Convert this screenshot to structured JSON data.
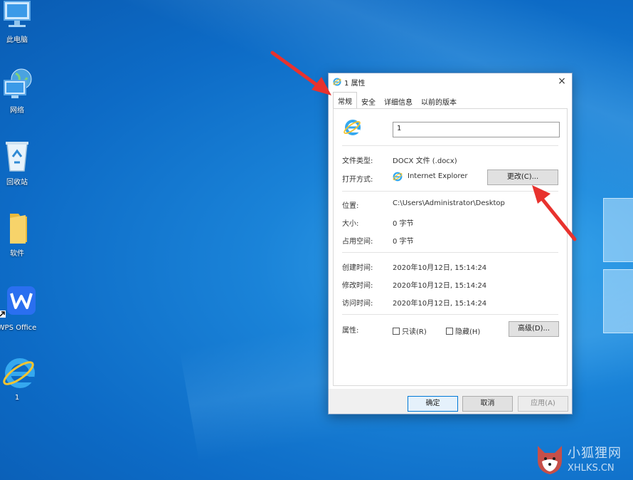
{
  "desktop": {
    "icons": [
      {
        "label": "此电脑",
        "icon": "computer-icon"
      },
      {
        "label": "网络",
        "icon": "network-icon"
      },
      {
        "label": "回收站",
        "icon": "recycle-bin-icon"
      },
      {
        "label": "软件",
        "icon": "folder-icon"
      },
      {
        "label": "WPS Office",
        "icon": "wps-office-icon"
      },
      {
        "label": "1",
        "icon": "internet-explorer-icon"
      }
    ]
  },
  "dialog": {
    "title": "1 属性",
    "close_label": "×",
    "tabs": [
      {
        "label": "常规",
        "active": true
      },
      {
        "label": "安全",
        "active": false
      },
      {
        "label": "详细信息",
        "active": false
      },
      {
        "label": "以前的版本",
        "active": false
      }
    ],
    "general": {
      "filename_value": "1",
      "file_type_label": "文件类型:",
      "file_type_value": "DOCX 文件 (.docx)",
      "opens_with_label": "打开方式:",
      "opens_with_value": "Internet Explorer",
      "change_button": "更改(C)...",
      "location_label": "位置:",
      "location_value": "C:\\Users\\Administrator\\Desktop",
      "size_label": "大小:",
      "size_value": "0 字节",
      "size_on_disk_label": "占用空间:",
      "size_on_disk_value": "0 字节",
      "created_label": "创建时间:",
      "created_value": "2020年10月12日, 15:14:24",
      "modified_label": "修改时间:",
      "modified_value": "2020年10月12日, 15:14:24",
      "accessed_label": "访问时间:",
      "accessed_value": "2020年10月12日, 15:14:24",
      "attributes_label": "属性:",
      "readonly_label": "只读(R)",
      "hidden_label": "隐藏(H)",
      "advanced_button": "高级(D)..."
    },
    "footer": {
      "ok_button": "确定",
      "cancel_button": "取消",
      "apply_button": "应用(A)"
    }
  },
  "watermark": {
    "cn": "小狐狸网",
    "en": "XHLKS.CN"
  },
  "colors": {
    "arrow": "#e8322e",
    "desktop_blue": "#0d6bc6",
    "accent": "#0078d7"
  }
}
